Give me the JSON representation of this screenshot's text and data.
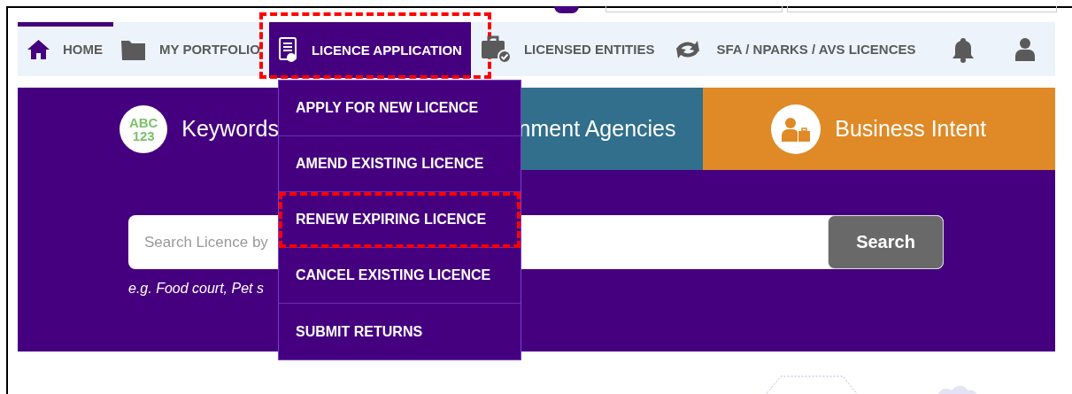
{
  "nav": {
    "items": [
      {
        "kind": "home",
        "label": "HOME",
        "selected": false,
        "highlighted": false
      },
      {
        "kind": "folder",
        "label": "MY PORTFOLIO",
        "selected": false,
        "highlighted": false
      },
      {
        "kind": "certificate",
        "label": "LICENCE APPLICATION",
        "selected": true,
        "highlighted": true
      },
      {
        "kind": "briefcase",
        "label": "LICENSED ENTITIES",
        "selected": false,
        "highlighted": false
      },
      {
        "kind": "sync",
        "label": "SFA / NPARKS / AVS LICENCES",
        "selected": false,
        "highlighted": false
      }
    ]
  },
  "dropdown": {
    "items": [
      {
        "label": "APPLY FOR NEW LICENCE",
        "highlighted": false
      },
      {
        "label": "AMEND EXISTING LICENCE",
        "highlighted": false
      },
      {
        "label": "RENEW EXPIRING LICENCE",
        "highlighted": true
      },
      {
        "label": "CANCEL EXISTING LICENCE",
        "highlighted": false
      },
      {
        "label": "SUBMIT RETURNS",
        "highlighted": false
      }
    ]
  },
  "search_tabs": [
    {
      "kind": "keywords",
      "label": "Keywords",
      "badge": [
        "ABC",
        "123"
      ],
      "color": "#45007f"
    },
    {
      "kind": "agencies",
      "label": "nment Agencies",
      "color": "#316f8c"
    },
    {
      "kind": "intent",
      "label": "Business Intent",
      "color": "#df8a26"
    }
  ],
  "search": {
    "placeholder": "Search Licence by",
    "button": "Search",
    "hint": "e.g. Food court, Pet s"
  }
}
